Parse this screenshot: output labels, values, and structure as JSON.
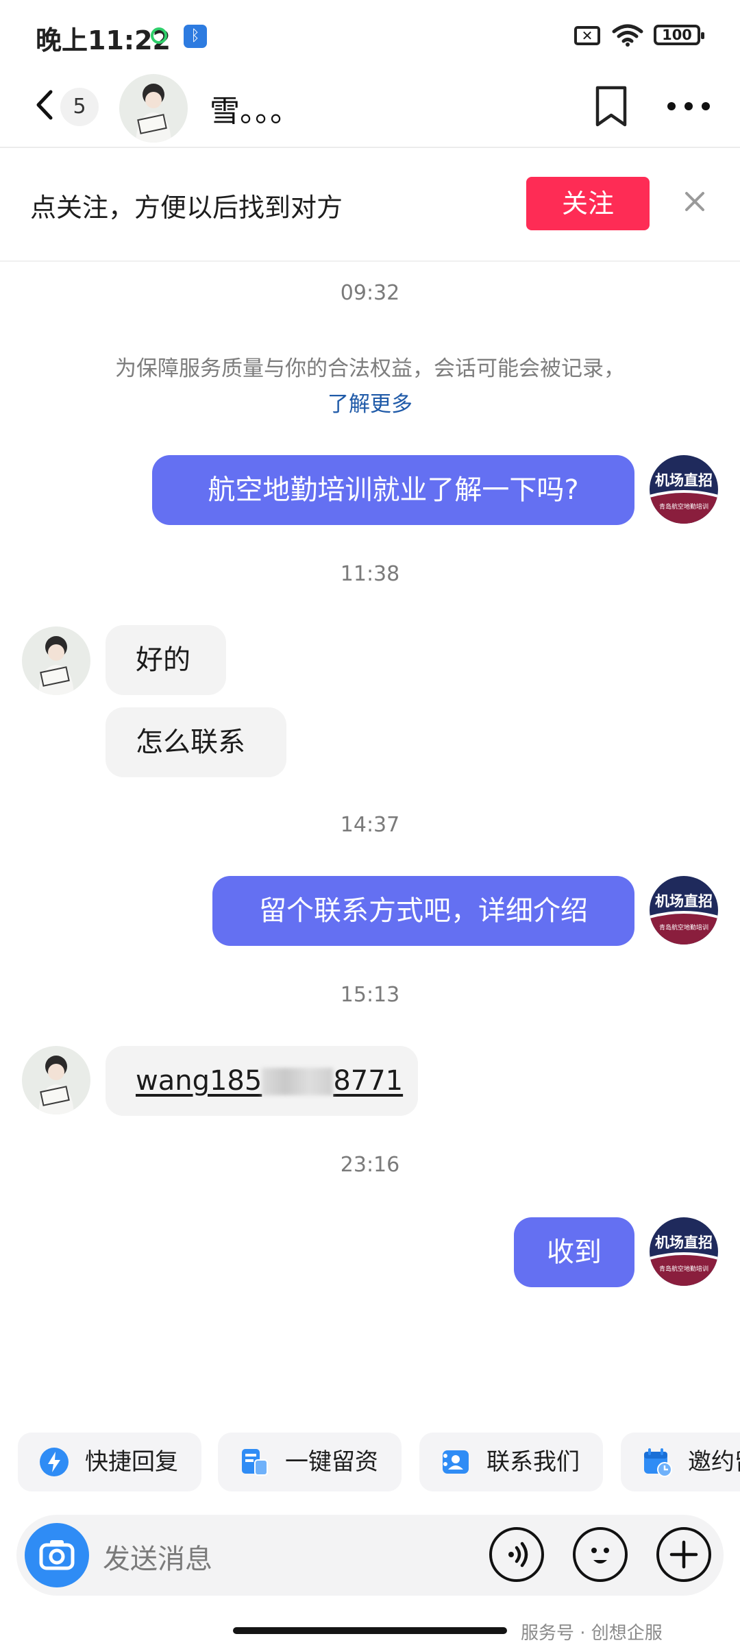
{
  "status_bar": {
    "time": "晚上11:22",
    "battery": "100"
  },
  "header": {
    "unread_count": "5",
    "contact_name": "雪。。。"
  },
  "follow_bar": {
    "prompt": "点关注，方便以后找到对方",
    "follow_label": "关注"
  },
  "chat": {
    "notice": "为保障服务质量与你的合法权益，会话可能会被记录，",
    "notice_link": "了解更多",
    "brand_avatar": {
      "title": "机场直招",
      "subtitle": "青岛航空地勤培训"
    },
    "messages": [
      {
        "timestamp": "09:32"
      },
      {
        "direction": "out",
        "text": "航空地勤培训就业了解一下吗?"
      },
      {
        "timestamp": "11:38"
      },
      {
        "direction": "in",
        "text": "好的"
      },
      {
        "direction": "in",
        "text": "怎么联系"
      },
      {
        "timestamp": "14:37"
      },
      {
        "direction": "out",
        "text": "留个联系方式吧，详细介绍"
      },
      {
        "timestamp": "15:13"
      },
      {
        "direction": "in",
        "text_prefix": "wang185",
        "text_suffix": "8771",
        "has_masked_digits": true
      },
      {
        "timestamp": "23:16"
      },
      {
        "direction": "out",
        "text": "收到"
      }
    ]
  },
  "quick_actions": [
    {
      "label": "快捷回复",
      "icon": "lightning-icon",
      "color": "#2f8cf5"
    },
    {
      "label": "一键留资",
      "icon": "form-icon",
      "color": "#2f8cf5"
    },
    {
      "label": "联系我们",
      "icon": "contact-card-icon",
      "color": "#2f8cf5"
    },
    {
      "label": "邀约留",
      "icon": "calendar-icon",
      "color": "#2f8cf5"
    }
  ],
  "input_bar": {
    "placeholder": "发送消息"
  },
  "watermark": "服务号 · 创想企服",
  "colors": {
    "bubble_out": "#6470f2",
    "bubble_in": "#f3f3f3",
    "follow_button": "#fe2c55",
    "accent_blue": "#2f8cf5",
    "link": "#1f5aa8"
  }
}
